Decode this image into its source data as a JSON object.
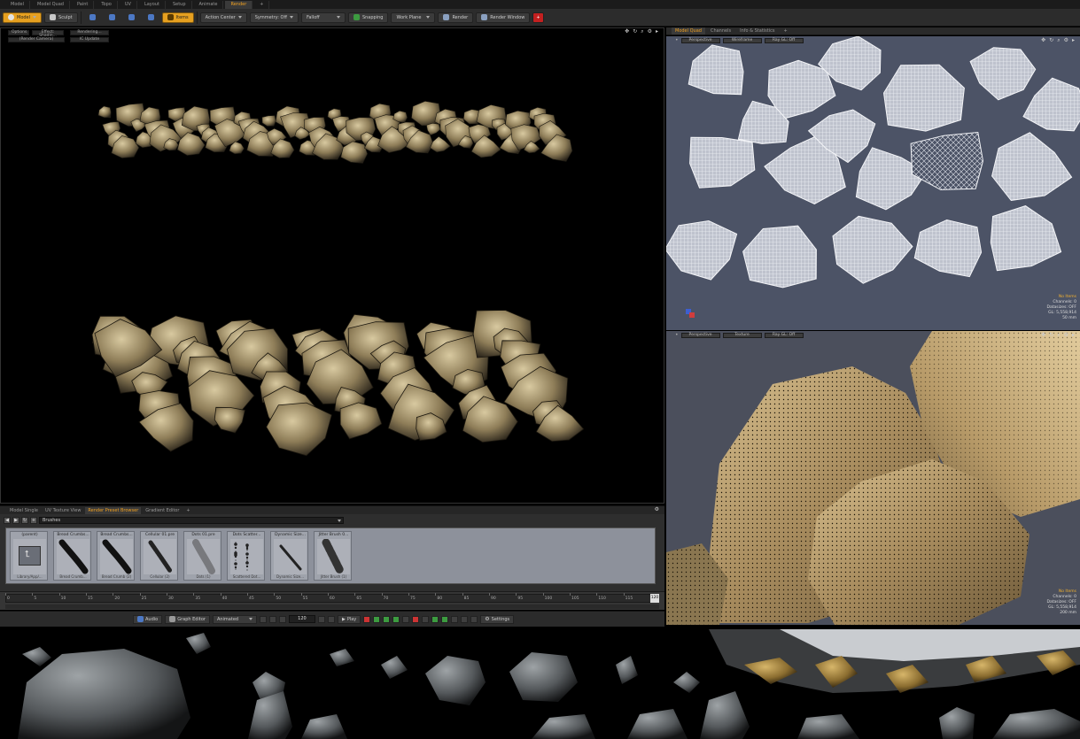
{
  "layout_tabs": [
    "Model",
    "Model Quad",
    "Paint",
    "Topo",
    "UV",
    "Layout",
    "Setup",
    "Animate",
    "Render",
    "+"
  ],
  "active_layout_tab": "Render",
  "toolbar": {
    "model_label": "Model",
    "sculpt_label": "Sculpt",
    "items_label": "Items",
    "action_center_label": "Action Center",
    "symmetry_label": "Symmetry: Off",
    "falloff_label": "Falloff",
    "snapping_label": "Snapping",
    "work_plane_label": "Work Plane",
    "render_label": "Render",
    "render_window_label": "Render Window",
    "add_label": "+"
  },
  "render_viewport": {
    "options_label": "Options",
    "effect_label": "Effect: Shadin...",
    "rendering_label": "Rendering...",
    "render_camera_label": "(Render Camera)",
    "ic_update_label": "IC Update"
  },
  "right_tabs": [
    "Model Quad",
    "Channels",
    "Info & Statistics",
    "+"
  ],
  "viewport_top": {
    "view_label": "Perspective",
    "shading_label": "Wireframe",
    "raygl_label": "Ray GL: Off",
    "stats": {
      "title": "No Items",
      "channels": "Channels: 0",
      "datasizes": "Datasizes: OFF",
      "gl": "GL: 5,558,914",
      "unit": "50 mm"
    }
  },
  "viewport_bottom": {
    "view_label": "Perspective",
    "shading_label": "Texture",
    "raygl_label": "Ray GL: Off",
    "stats": {
      "title": "No Items",
      "channels": "Channels: 0",
      "datasizes": "Datasizes: OFF",
      "gl": "GL: 5,558,914",
      "unit": "200 mm"
    }
  },
  "bottom_tabs": [
    "Model Single",
    "UV Texture View",
    "Render Preset Browser",
    "Gradient Editor",
    "+"
  ],
  "active_bottom_tab": "Render Preset Browser",
  "preset_browser": {
    "back_label": "◀",
    "forward_label": "▶",
    "refresh_label": "↻",
    "add_label": "+",
    "path": "Brushes",
    "items": [
      {
        "name": "(parent)",
        "file": "Library/App/..."
      },
      {
        "name": "Bread Crumbs...",
        "file": "Bread Crumb..."
      },
      {
        "name": "Bread Crumbs...",
        "file": "Bread Crumb (2)"
      },
      {
        "name": "Cellular 01.pre",
        "file": "Cellular (2)"
      },
      {
        "name": "Dots 01.pre",
        "file": "Dots (1)"
      },
      {
        "name": "Dots Scatter...",
        "file": "Scattered Dot..."
      },
      {
        "name": "Dynamic Size...",
        "file": "Dynamic Size..."
      },
      {
        "name": "Jitter Brush 0...",
        "file": "Jitter Brush (1)"
      }
    ]
  },
  "timeline": {
    "labels": [
      "0",
      "5",
      "10",
      "15",
      "20",
      "25",
      "30",
      "35",
      "40",
      "45",
      "50",
      "55",
      "60",
      "65",
      "70",
      "75",
      "80",
      "85",
      "90",
      "95",
      "100",
      "105",
      "110",
      "115",
      "120"
    ],
    "end_value": "120"
  },
  "transport": {
    "audio_label": "Audio",
    "graph_editor_label": "Graph Editor",
    "animated_label": "Animated",
    "frame": "120",
    "play_label": "Play",
    "settings_label": "Settings"
  },
  "colors": {
    "accent": "#f0a020",
    "viewport_bg": "#4c5366",
    "panel": "#2e2e2e"
  }
}
